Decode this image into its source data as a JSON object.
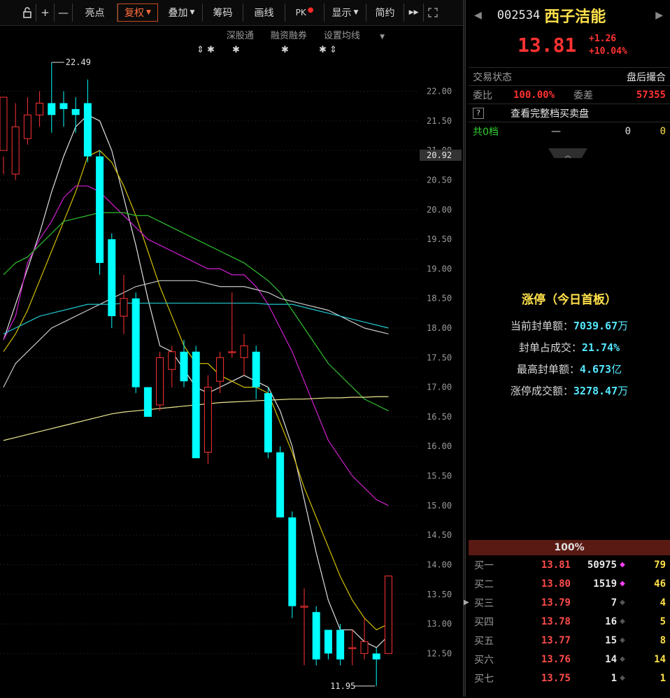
{
  "toolbar": {
    "lock_icon": "lock-icon",
    "plus_label": "+",
    "minus_label": "—",
    "highlight_label": "亮点",
    "restore_label": "复权",
    "overlay_label": "叠加",
    "chips_label": "筹码",
    "draw_label": "画线",
    "pk_label": "PK",
    "display_label": "显示",
    "simple_label": "简约",
    "next_label": "▶▶",
    "fullscreen_icon": "fullscreen-icon"
  },
  "subbar": {
    "shenguotong": "深股通",
    "margin": "融资融券",
    "ma_settings": "设置均线"
  },
  "chart": {
    "high_label": "22.49",
    "low_label": "11.95",
    "current_price_tag": "20.92",
    "ylim": [
      12.15,
      22.55
    ],
    "yticks": [
      "22.00",
      "21.50",
      "21.00",
      "20.50",
      "20.00",
      "19.50",
      "19.00",
      "18.50",
      "18.00",
      "17.50",
      "17.00",
      "16.50",
      "16.00",
      "15.50",
      "15.00",
      "14.50",
      "14.00",
      "13.50",
      "13.00",
      "12.50"
    ]
  },
  "chart_data": {
    "type": "candlestick",
    "ohlc": [
      [
        21.0,
        21.9,
        20.9,
        20.6
      ],
      [
        20.6,
        21.4,
        21.8,
        20.5
      ],
      [
        21.2,
        21.6,
        21.9,
        21.1
      ],
      [
        21.6,
        21.8,
        22.0,
        21.4
      ],
      [
        21.8,
        21.6,
        22.49,
        21.3
      ],
      [
        21.8,
        21.7,
        22.0,
        21.4
      ],
      [
        21.7,
        21.6,
        21.9,
        21.3
      ],
      [
        21.8,
        20.9,
        22.2,
        20.8
      ],
      [
        20.9,
        19.1,
        21.0,
        18.9
      ],
      [
        19.5,
        18.2,
        19.6,
        18.0
      ],
      [
        18.2,
        18.5,
        18.9,
        17.9
      ],
      [
        18.5,
        17.0,
        18.6,
        16.9
      ],
      [
        17.0,
        16.5,
        17.0,
        16.5
      ],
      [
        16.7,
        17.5,
        17.6,
        16.6
      ],
      [
        17.3,
        17.6,
        17.7,
        17.0
      ],
      [
        17.6,
        17.1,
        17.8,
        17.0
      ],
      [
        17.6,
        15.8,
        17.7,
        15.8
      ],
      [
        15.9,
        17.0,
        17.2,
        15.7
      ],
      [
        17.1,
        17.5,
        17.6,
        16.9
      ],
      [
        17.6,
        17.6,
        18.6,
        17.5
      ],
      [
        17.5,
        17.7,
        17.9,
        17.2
      ],
      [
        17.6,
        17.0,
        17.7,
        16.8
      ],
      [
        16.9,
        15.9,
        17.0,
        15.8
      ],
      [
        15.9,
        14.8,
        16.0,
        14.8
      ],
      [
        14.8,
        13.3,
        14.9,
        13.1
      ],
      [
        13.3,
        13.3,
        13.6,
        12.3
      ],
      [
        13.2,
        12.4,
        13.3,
        12.3
      ],
      [
        12.9,
        12.5,
        12.9,
        12.4
      ],
      [
        12.9,
        12.4,
        13.0,
        12.3
      ],
      [
        12.6,
        12.6,
        12.9,
        12.3
      ],
      [
        12.5,
        12.7,
        13.1,
        12.4
      ],
      [
        12.5,
        12.4,
        12.6,
        11.95
      ],
      [
        12.5,
        13.81,
        13.81,
        12.5
      ]
    ],
    "ma_lines": [
      {
        "color": "#e0e0e0",
        "values": [
          17.8,
          18.4,
          19.0,
          19.6,
          20.3,
          20.9,
          21.4,
          21.6,
          21.5,
          21.0,
          20.2,
          19.4,
          18.5,
          17.7,
          17.6,
          17.3,
          17.0,
          16.9,
          17.0,
          17.1,
          17.2,
          17.1,
          17.0,
          16.6,
          16.0,
          15.1,
          14.2,
          13.4,
          12.9,
          12.9,
          12.7,
          12.6,
          12.8
        ]
      },
      {
        "color": "#d4c000",
        "values": [
          17.6,
          17.9,
          18.3,
          18.8,
          19.3,
          19.8,
          20.3,
          20.9,
          21.0,
          20.8,
          20.4,
          19.9,
          19.3,
          18.7,
          18.2,
          17.7,
          17.4,
          17.4,
          17.2,
          17.1,
          17.0,
          17.0,
          16.9,
          16.4,
          15.9,
          15.3,
          14.8,
          14.3,
          13.8,
          13.4,
          13.1,
          12.9,
          13.0
        ]
      },
      {
        "color": "#d020d0",
        "values": [
          17.8,
          18.2,
          19.1,
          19.5,
          19.8,
          20.2,
          20.4,
          20.4,
          20.3,
          20.1,
          19.9,
          19.7,
          19.5,
          19.4,
          19.3,
          19.2,
          19.1,
          19.0,
          19.0,
          18.9,
          18.9,
          18.7,
          18.4,
          18.0,
          17.6,
          17.1,
          16.6,
          16.1,
          15.8,
          15.5,
          15.3,
          15.1,
          15.0
        ]
      },
      {
        "color": "#30c030",
        "values": [
          18.9,
          19.1,
          19.2,
          19.4,
          19.6,
          19.8,
          19.85,
          19.9,
          19.95,
          19.95,
          19.95,
          19.9,
          19.9,
          19.8,
          19.7,
          19.6,
          19.5,
          19.4,
          19.3,
          19.2,
          19.1,
          18.95,
          18.8,
          18.6,
          18.3,
          18.0,
          17.7,
          17.4,
          17.2,
          17.0,
          16.8,
          16.7,
          16.6
        ]
      },
      {
        "color": "#c8c8c8",
        "values": [
          17.0,
          17.4,
          17.6,
          17.8,
          18.0,
          18.1,
          18.2,
          18.3,
          18.4,
          18.5,
          18.6,
          18.7,
          18.75,
          18.8,
          18.8,
          18.8,
          18.8,
          18.75,
          18.7,
          18.7,
          18.7,
          18.65,
          18.6,
          18.5,
          18.45,
          18.4,
          18.35,
          18.3,
          18.2,
          18.1,
          18.0,
          17.95,
          17.9
        ]
      },
      {
        "color": "#20c8d0",
        "values": [
          17.9,
          18.0,
          18.1,
          18.2,
          18.25,
          18.3,
          18.35,
          18.4,
          18.4,
          18.4,
          18.42,
          18.42,
          18.42,
          18.42,
          18.42,
          18.42,
          18.42,
          18.42,
          18.42,
          18.42,
          18.42,
          18.42,
          18.4,
          18.4,
          18.4,
          18.35,
          18.3,
          18.25,
          18.2,
          18.15,
          18.1,
          18.05,
          18.0
        ]
      },
      {
        "color": "#f0e890",
        "values": [
          16.1,
          16.15,
          16.2,
          16.25,
          16.3,
          16.35,
          16.4,
          16.45,
          16.5,
          16.55,
          16.58,
          16.6,
          16.62,
          16.64,
          16.66,
          16.68,
          16.7,
          16.72,
          16.74,
          16.75,
          16.76,
          16.77,
          16.78,
          16.79,
          16.8,
          16.8,
          16.81,
          16.82,
          16.82,
          16.83,
          16.83,
          16.84,
          16.84
        ]
      }
    ]
  },
  "quote": {
    "code": "002534",
    "name": "西子洁能",
    "price": "13.81",
    "change": "+1.26",
    "change_pct": "+10.04%"
  },
  "info": {
    "trade_status_label": "交易状态",
    "trade_status_value": "盘后撮合",
    "ratio_label": "委比",
    "ratio_value": "100.00%",
    "diff_label": "委差",
    "diff_value": "57355",
    "full_book_link": "查看完整档买卖盘",
    "help_mark": "?",
    "levels_label": "共0档",
    "levels_dash": "—",
    "levels_a": "0",
    "levels_b": "0"
  },
  "limit": {
    "title": "涨停（今日首板）",
    "stats": [
      {
        "label": "当前封单额：",
        "value": "7039.67",
        "unit": "万"
      },
      {
        "label": "封单占成交：",
        "value": "21.74%",
        "unit": ""
      },
      {
        "label": "最高封单额：",
        "value": "4.673",
        "unit": "亿"
      },
      {
        "label": "涨停成交额：",
        "value": "3278.47",
        "unit": "万"
      }
    ]
  },
  "book": {
    "pct": "100%",
    "rows": [
      {
        "label": "买一",
        "price": "13.81",
        "vol": "50975",
        "dot": "magenta",
        "count": "79"
      },
      {
        "label": "买二",
        "price": "13.80",
        "vol": "1519",
        "dot": "magenta",
        "count": "46"
      },
      {
        "label": "买三",
        "price": "13.79",
        "vol": "7",
        "dot": "grey",
        "count": "4"
      },
      {
        "label": "买四",
        "price": "13.78",
        "vol": "16",
        "dot": "grey",
        "count": "5"
      },
      {
        "label": "买五",
        "price": "13.77",
        "vol": "15",
        "dot": "grey",
        "count": "8"
      },
      {
        "label": "买六",
        "price": "13.76",
        "vol": "14",
        "dot": "grey",
        "count": "14"
      },
      {
        "label": "买七",
        "price": "13.75",
        "vol": "1",
        "dot": "grey",
        "count": "1"
      }
    ]
  },
  "colors": {
    "up": "#ff3232",
    "down": "#00ffff",
    "accent": "#ff6a3a",
    "yellow": "#ffe14a",
    "cyan": "#55e8ff"
  }
}
